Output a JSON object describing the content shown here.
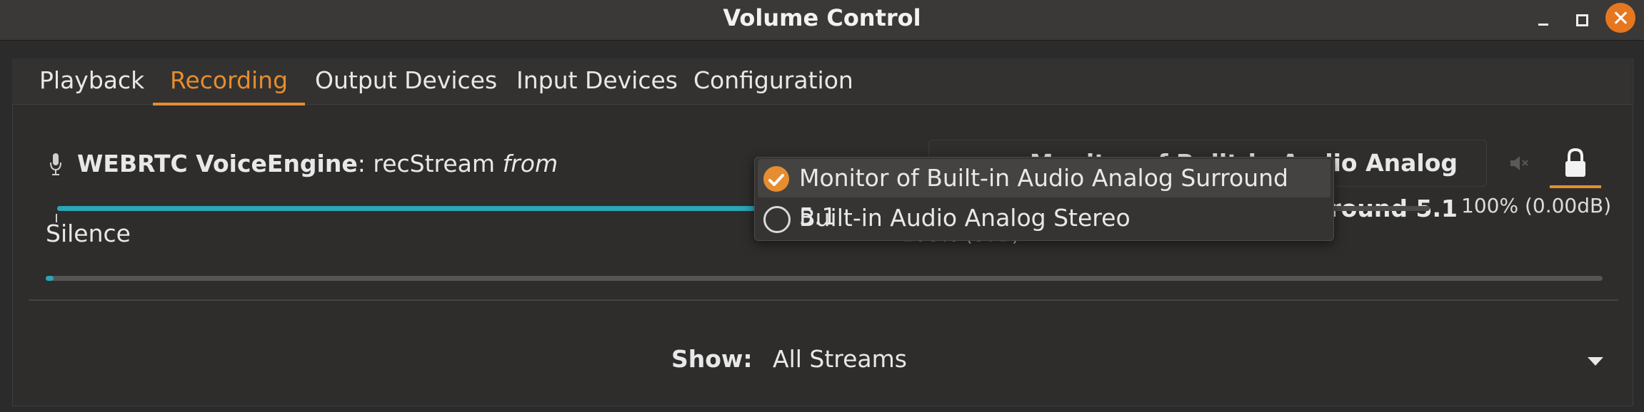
{
  "window": {
    "title": "Volume Control"
  },
  "tabs": [
    {
      "label": "Playback"
    },
    {
      "label": "Recording"
    },
    {
      "label": "Output Devices"
    },
    {
      "label": "Input Devices"
    },
    {
      "label": "Configuration"
    }
  ],
  "stream": {
    "app_name": "WEBRTC VoiceEngine",
    "separator": ": ",
    "stream_name": "recStream",
    "from_text": "from",
    "device_button_label": "Monitor of Built-in Audio Analog Surround 5.1",
    "volume_percent": 100,
    "volume_label": "100% (0.00dB)",
    "silence_label": "Silence",
    "reference_label": "100% (0dB)",
    "peak_level_percent": 0.5
  },
  "device_popup": {
    "items": [
      {
        "label": "Monitor of Built-in Audio Analog Surround 5.1",
        "selected": true
      },
      {
        "label": "Built-in Audio Analog Stereo",
        "selected": false
      }
    ]
  },
  "footer": {
    "show_label": "Show:",
    "show_value": "All Streams"
  },
  "icons": {
    "mic": "microphone-icon",
    "mute": "speaker-mute-icon",
    "lock": "lock-icon",
    "dropdown": "chevron-down-icon",
    "check": "check-icon"
  },
  "colors": {
    "accent": "#e58d2f",
    "slider": "#2aa6b5",
    "background": "#2b2b2b"
  }
}
